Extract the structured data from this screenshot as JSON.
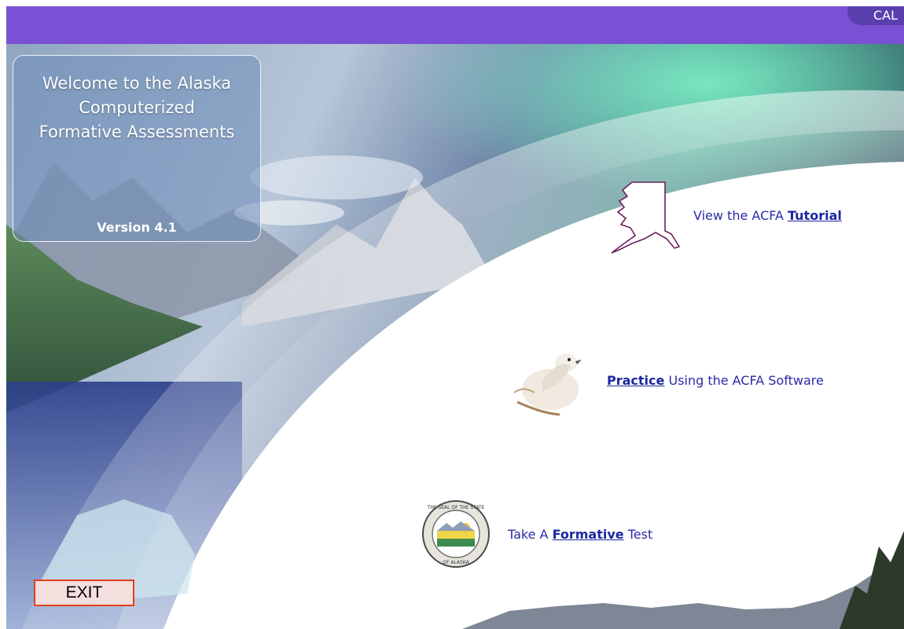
{
  "topbar": {
    "corner_label": "CAL",
    "color": "#7a50d4"
  },
  "welcome": {
    "title": "Welcome to the Alaska Computerized Formative Assessments",
    "version": "Version 4.1"
  },
  "menu": {
    "tutorial": {
      "prefix": "View the ACFA ",
      "link": "Tutorial",
      "suffix": "",
      "icon": "alaska-map-icon"
    },
    "practice": {
      "prefix": "",
      "link": "Practice",
      "suffix": " Using the ACFA Software",
      "icon": "ptarmigan-bird-icon"
    },
    "formative": {
      "prefix": "Take A ",
      "link": "Formative",
      "suffix": " Test",
      "icon": "alaska-state-seal-icon"
    }
  },
  "exit_button": {
    "label": "EXIT"
  },
  "colors": {
    "link": "#1b26a0",
    "exit_border": "#e2401c"
  }
}
